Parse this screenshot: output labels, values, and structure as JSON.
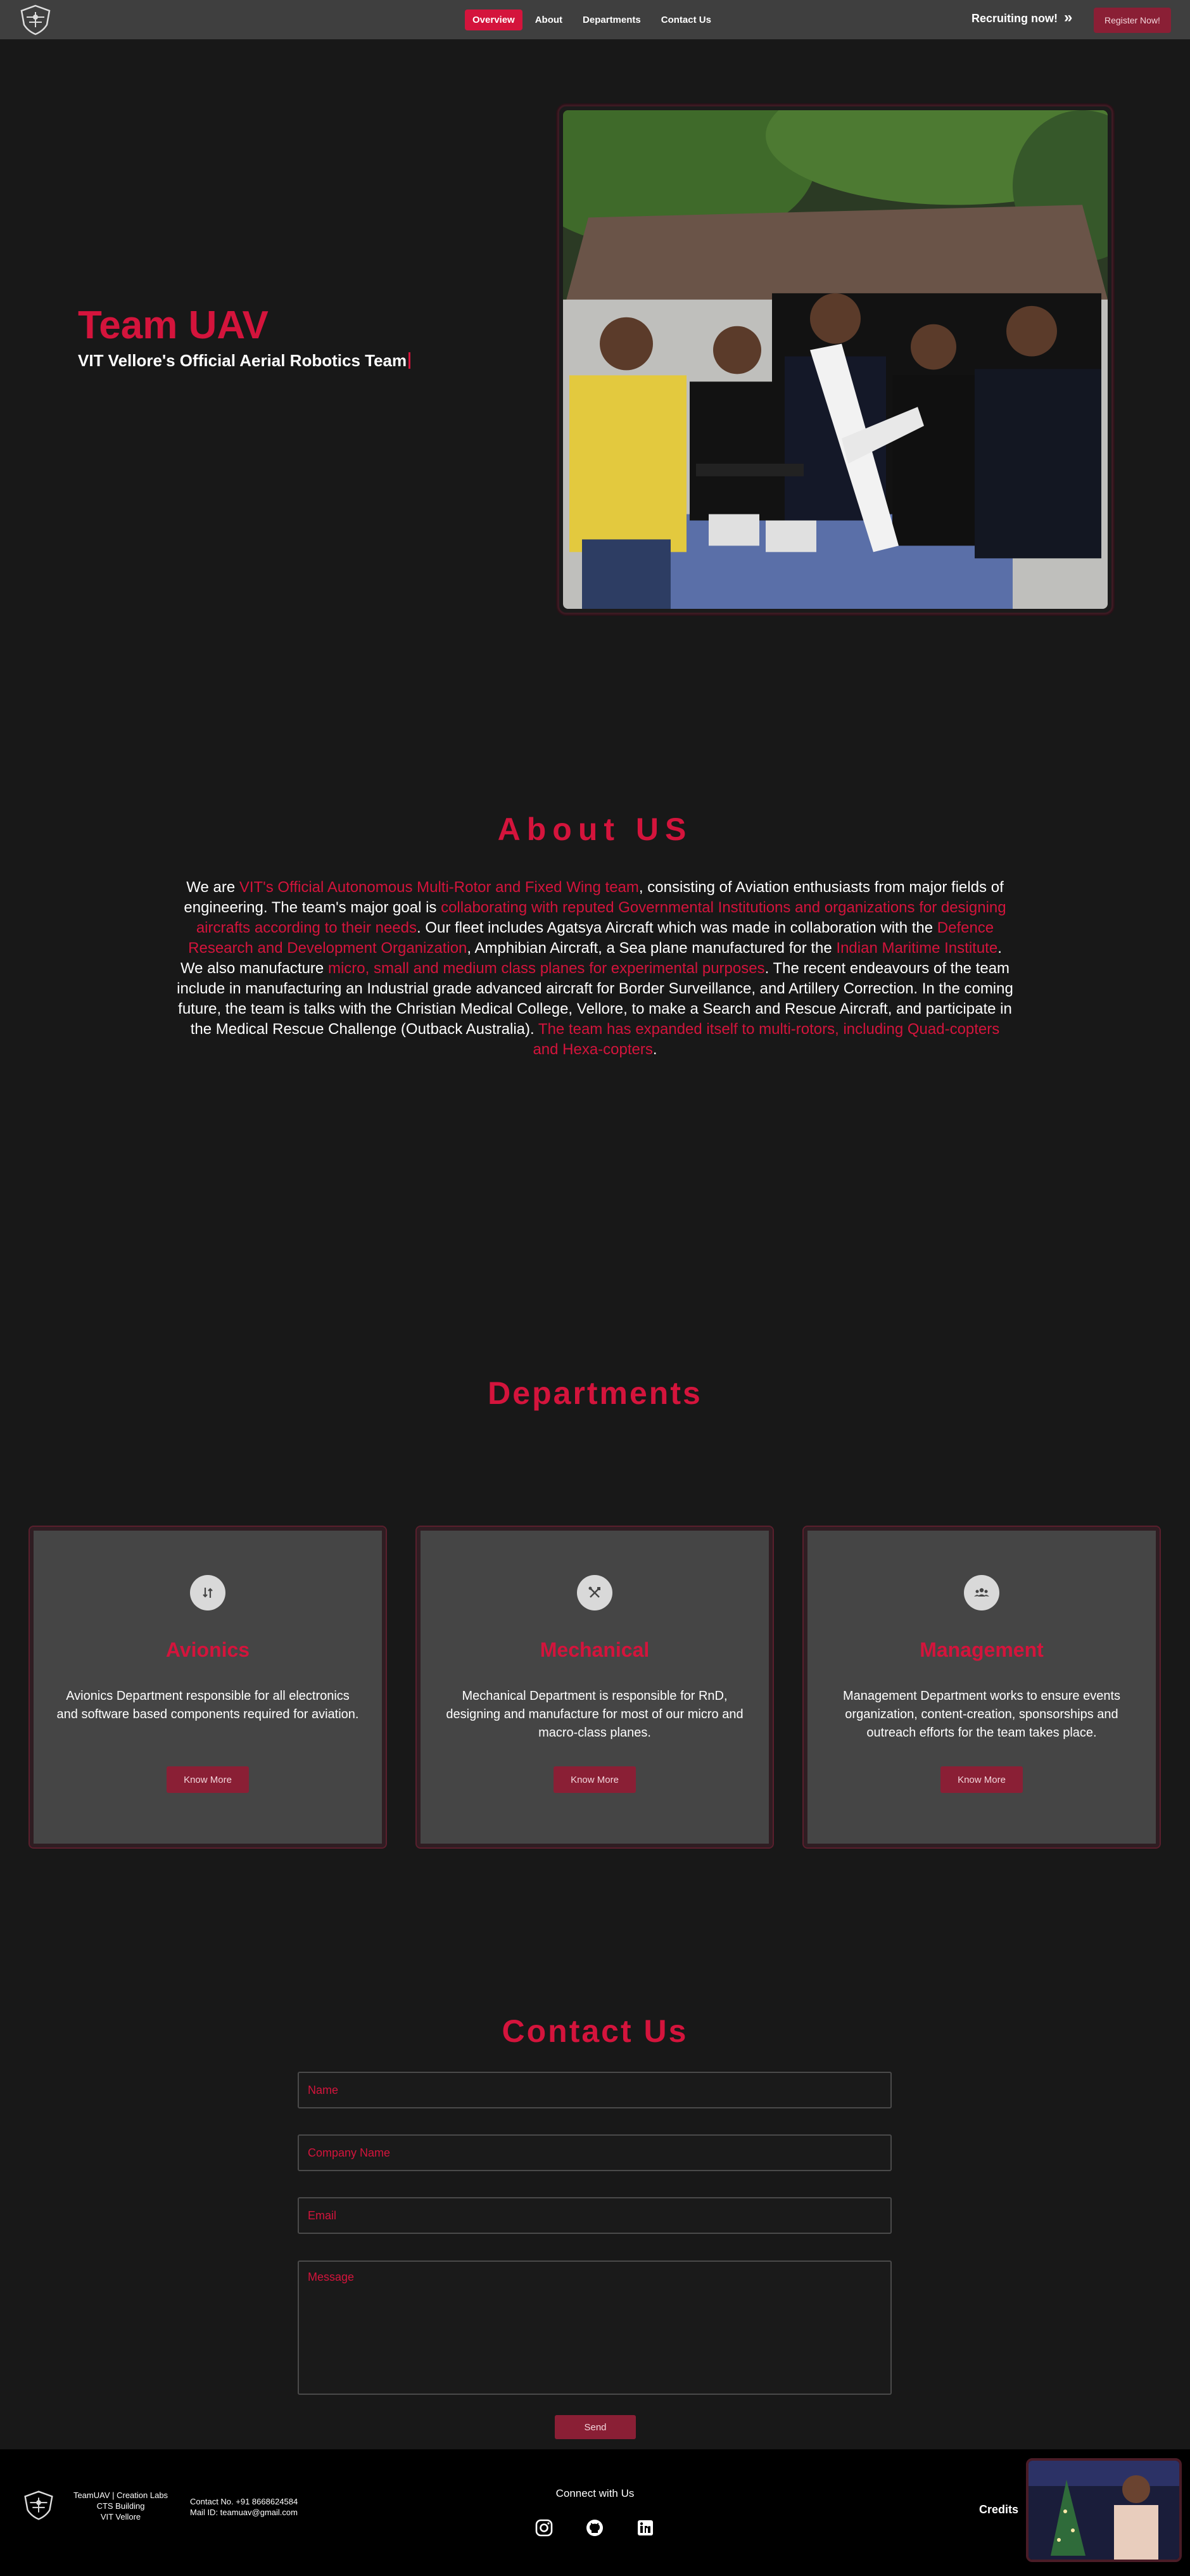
{
  "nav": {
    "links": [
      "Overview",
      "About",
      "Departments",
      "Contact Us"
    ],
    "recruiting": "Recruiting now!",
    "chevron": "»",
    "register": "Register Now!"
  },
  "hero": {
    "title": "Team UAV",
    "subtitle": "VIT Vellore's Official Aerial Robotics Team"
  },
  "about": {
    "title": "About US",
    "segments": [
      {
        "text": "We are ",
        "hl": false
      },
      {
        "text": "VIT's Official Autonomous Multi-Rotor and Fixed Wing team",
        "hl": true
      },
      {
        "text": ", consisting of Aviation enthusiasts from major fields of engineering. The team's major goal is ",
        "hl": false
      },
      {
        "text": "collaborating with reputed Governmental Institutions and organizations for designing aircrafts according to their needs",
        "hl": true
      },
      {
        "text": ". Our fleet includes Agatsya Aircraft which was made in collaboration with the ",
        "hl": false
      },
      {
        "text": "Defence Research and Development Organization",
        "hl": true
      },
      {
        "text": ", Amphibian Aircraft, a Sea plane manufactured for the ",
        "hl": false
      },
      {
        "text": "Indian Maritime Institute",
        "hl": true
      },
      {
        "text": ". We also manufacture ",
        "hl": false
      },
      {
        "text": "micro, small and medium class planes for experimental purposes",
        "hl": true
      },
      {
        "text": ". The recent endeavours of the team include in manufacturing an Industrial grade advanced aircraft for Border Surveillance, and Artillery Correction. In the coming future, the team is talks with the Christian Medical College, Vellore, to make a Search and Rescue Aircraft, and participate in the Medical Rescue Challenge (Outback Australia). ",
        "hl": false
      },
      {
        "text": "The team has expanded itself to multi-rotors, including Quad-copters and Hexa-copters",
        "hl": true
      },
      {
        "text": ".",
        "hl": false
      }
    ]
  },
  "departments": {
    "title": "Departments",
    "cards": [
      {
        "icon": "avionics-icon",
        "title": "Avionics",
        "desc": "Avionics Department responsible for all electronics and software based components required for aviation.",
        "button": "Know More"
      },
      {
        "icon": "tools-icon",
        "title": "Mechanical",
        "desc": "Mechanical Department is responsible for RnD, designing and manufacture for most of our micro and macro-class planes.",
        "button": "Know More"
      },
      {
        "icon": "people-icon",
        "title": "Management",
        "desc": "Management Department works to ensure events organization, content-creation, sponsorships and outreach efforts for the team takes place.",
        "button": "Know More"
      }
    ]
  },
  "contact": {
    "title": "Contact Us",
    "name_placeholder": "Name",
    "company_placeholder": "Company Name",
    "email_placeholder": "Email",
    "message_placeholder": "Message",
    "send": "Send"
  },
  "footer": {
    "address": [
      "TeamUAV | Creation Labs",
      "CTS Building",
      "VIT Vellore"
    ],
    "contact_no": "Contact No. +91 8668624584",
    "mail": "Mail ID: teamuav@gmail.com",
    "connect": "Connect with Us",
    "socials": [
      "instagram-icon",
      "github-icon",
      "linkedin-icon"
    ],
    "credits": "Credits"
  },
  "colors": {
    "accent": "#d4143c",
    "button": "#8a1f35",
    "background": "#181818",
    "card": "#454545",
    "nav": "#3f3f3f"
  }
}
